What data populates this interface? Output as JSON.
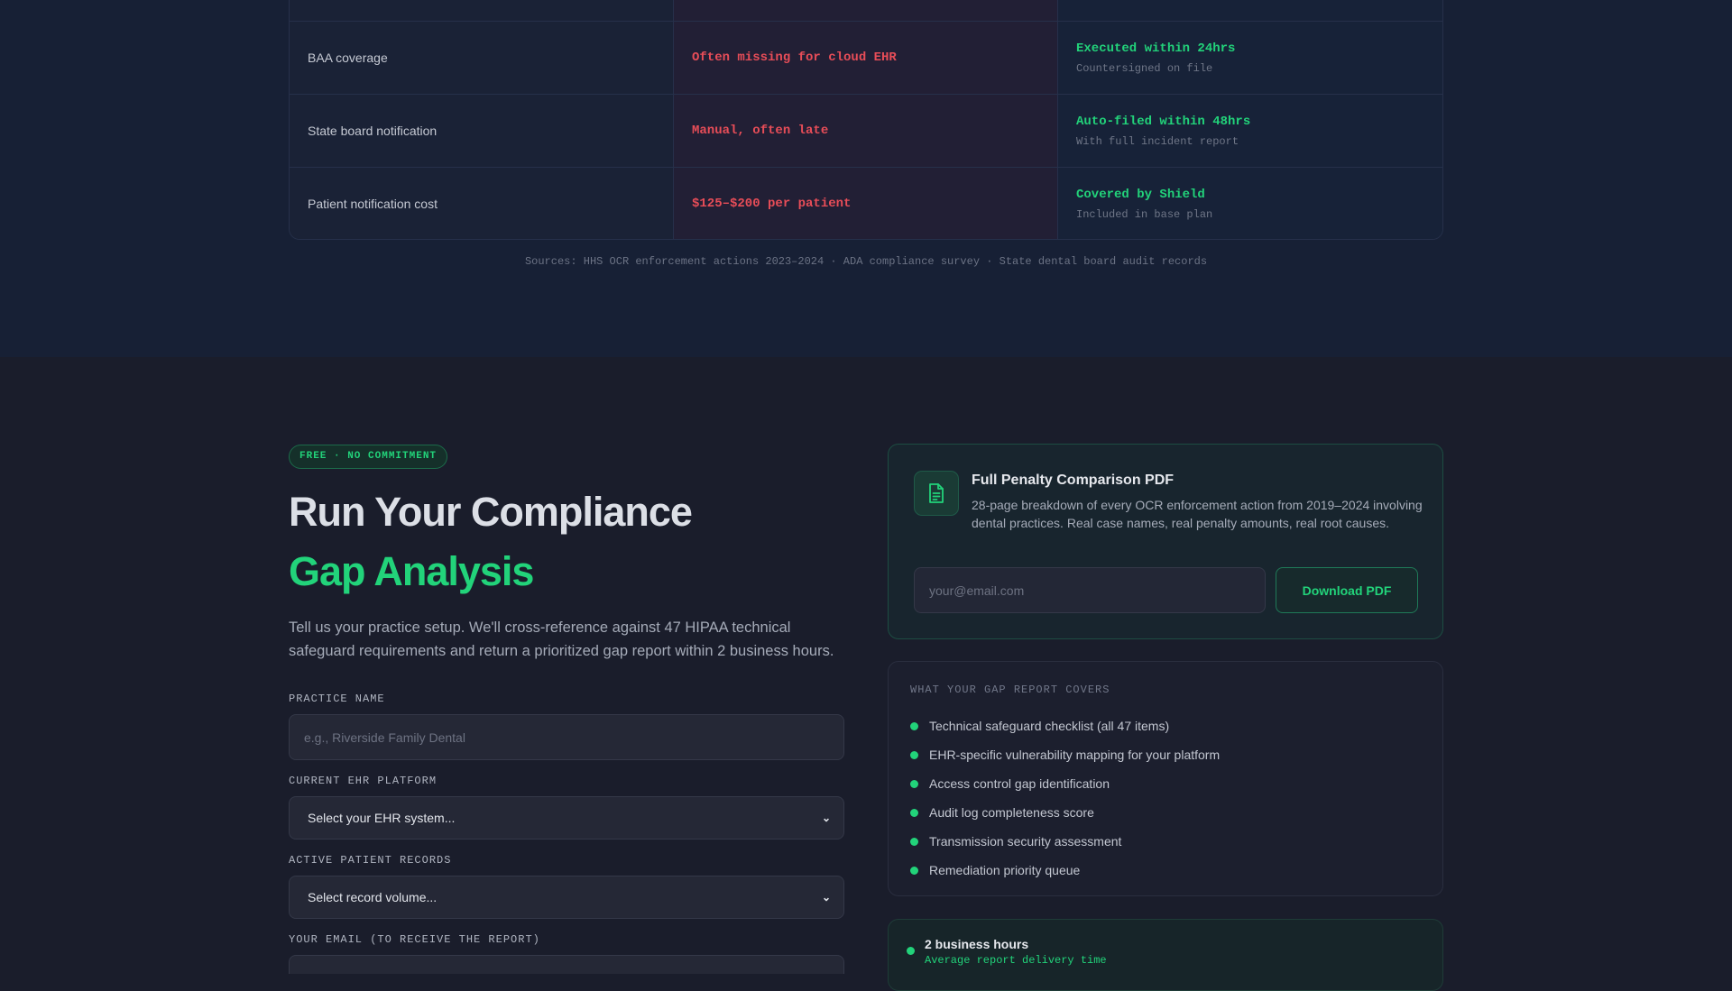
{
  "comparison": {
    "rows": [
      {
        "label": "",
        "bad": "",
        "good": "",
        "good_sub": ""
      },
      {
        "label": "BAA coverage",
        "bad": "Often missing for cloud EHR",
        "good": "Executed within 24hrs",
        "good_sub": "Countersigned on file"
      },
      {
        "label": "State board notification",
        "bad": "Manual, often late",
        "good": "Auto-filed within 48hrs",
        "good_sub": "With full incident report"
      },
      {
        "label": "Patient notification cost",
        "bad": "$125–$200 per patient",
        "good": "Covered by Shield",
        "good_sub": "Included in base plan"
      }
    ],
    "sources": "Sources: HHS OCR enforcement actions 2023–2024 · ADA compliance survey · State dental board audit records"
  },
  "hero": {
    "badge": "FREE · NO COMMITMENT",
    "title_line1": "Run Your Compliance",
    "title_line2": "Gap Analysis",
    "intro": "Tell us your practice setup. We'll cross-reference against 47 HIPAA technical safeguard requirements and return a prioritized gap report within 2 business hours."
  },
  "form": {
    "practice_label": "PRACTICE NAME",
    "practice_placeholder": "e.g., Riverside Family Dental",
    "ehr_label": "CURRENT EHR PLATFORM",
    "ehr_value": "Select your EHR system...",
    "records_label": "ACTIVE PATIENT RECORDS",
    "records_value": "Select record volume...",
    "email_label": "YOUR EMAIL (TO RECEIVE THE REPORT)"
  },
  "pdf_card": {
    "icon": "document-icon",
    "title": "Full Penalty Comparison PDF",
    "description": "28-page breakdown of every OCR enforcement action from 2019–2024 involving dental practices. Real case names, real penalty amounts, real root causes.",
    "email_placeholder": "your@email.com",
    "button": "Download PDF"
  },
  "covers": {
    "title": "WHAT YOUR GAP REPORT COVERS",
    "items": [
      "Technical safeguard checklist (all 47 items)",
      "EHR-specific vulnerability mapping for your platform",
      "Access control gap identification",
      "Audit log completeness score",
      "Transmission security assessment",
      "Remediation priority queue"
    ]
  },
  "delivery": {
    "main": "2 business hours",
    "sub": "Average report delivery time"
  },
  "colors": {
    "accent": "#22d37a",
    "danger": "#e84d58",
    "top_bg": "#172035",
    "page_bg": "#1a1d2b"
  }
}
